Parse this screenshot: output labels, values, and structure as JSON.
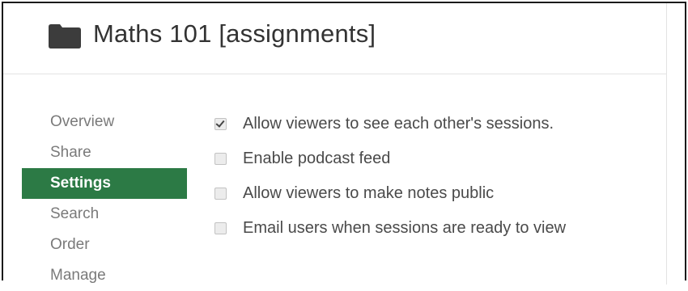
{
  "header": {
    "icon": "folder-icon",
    "title": "Maths 101 [assignments]"
  },
  "sidebar": {
    "items": [
      {
        "label": "Overview",
        "active": false
      },
      {
        "label": "Share",
        "active": false
      },
      {
        "label": "Settings",
        "active": true
      },
      {
        "label": "Search",
        "active": false
      },
      {
        "label": "Order",
        "active": false
      },
      {
        "label": "Manage",
        "active": false
      }
    ]
  },
  "settings": {
    "options": [
      {
        "label": "Allow viewers to see each other's sessions.",
        "checked": true
      },
      {
        "label": "Enable podcast feed",
        "checked": false
      },
      {
        "label": "Allow viewers to make notes public",
        "checked": false
      },
      {
        "label": "Email users when sessions are ready to view",
        "checked": false
      }
    ]
  },
  "colors": {
    "active_nav_bg": "#2c7a45",
    "title_text": "#333333",
    "nav_text": "#7a7a7a"
  }
}
